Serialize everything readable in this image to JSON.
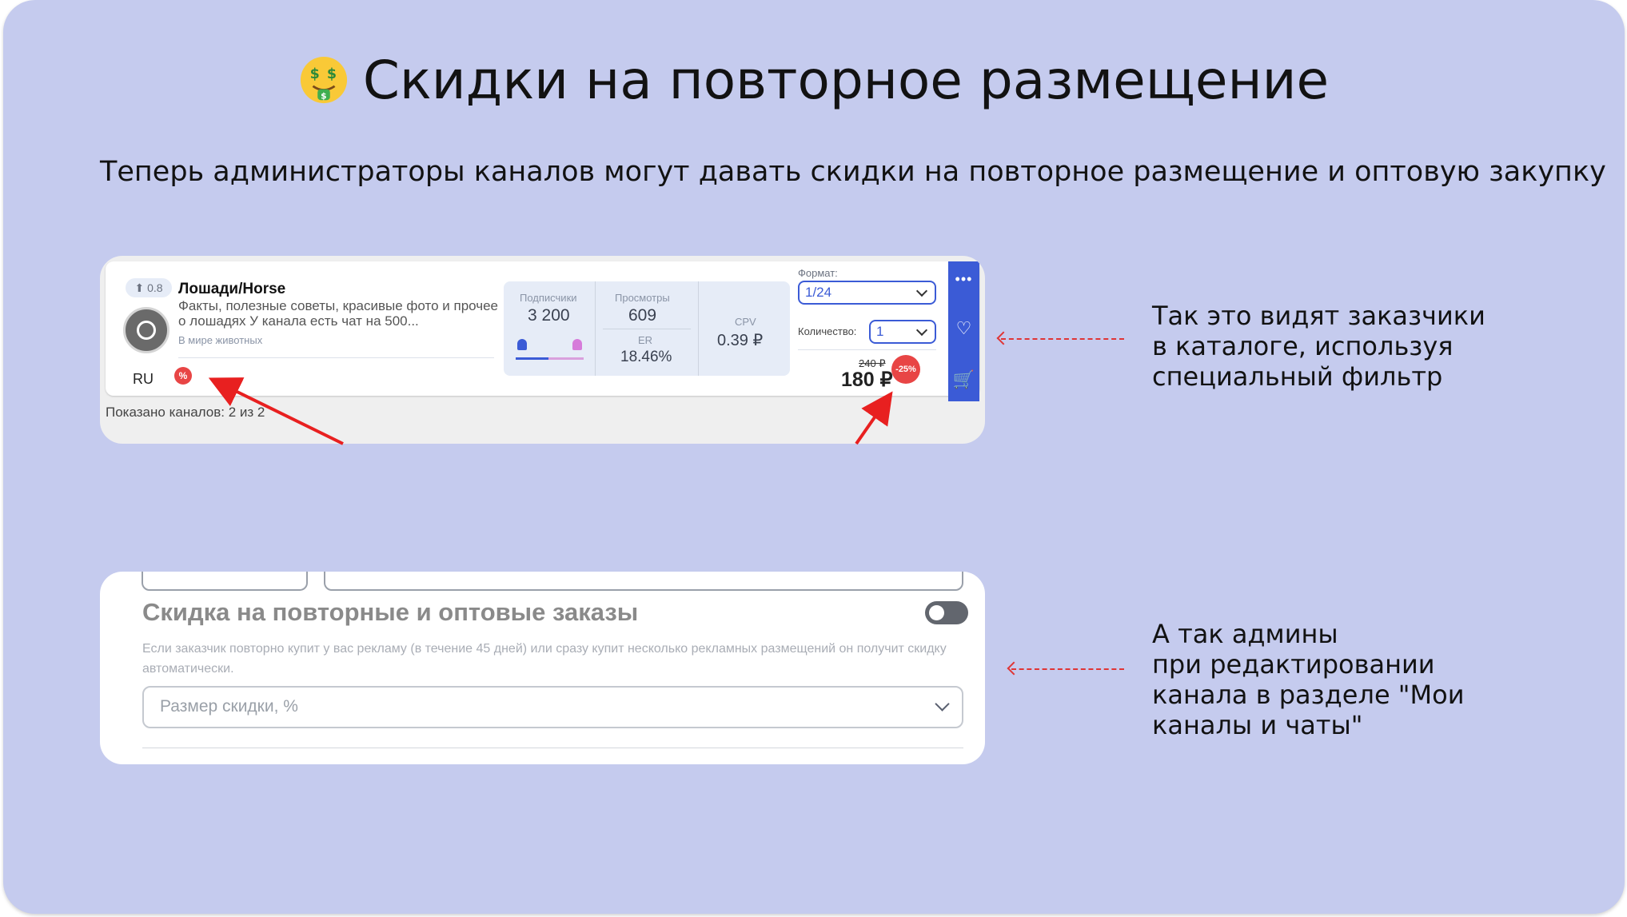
{
  "slide": {
    "title": "Скидки на повторное размещение",
    "title_emoji": "money-mouth-face-icon",
    "subtitle": "Теперь администраторы каналов могут давать скидки на повторное размещение и оптовую закупку",
    "note1": [
      "Так это видят заказчики",
      "в каталоге, используя",
      "специальный фильтр"
    ],
    "note2": [
      "А так админы",
      "при редактировании",
      "канала в разделе \"Мои",
      "каналы и чаты\""
    ],
    "accent_color": "#e03535",
    "background_color": "#c5cbee"
  },
  "catalog_card": {
    "rating": "0.8",
    "channel_name": "Лошади/Horse",
    "description": "Факты, полезные советы, красивые фото и прочее о лошадях У канала есть чат на 500...",
    "category": "В мире животных",
    "language": "RU",
    "discount_badge": "%",
    "stats": {
      "subscribers_label": "Подписчики",
      "subscribers": "3 200",
      "views_label": "Просмотры",
      "views": "609",
      "er_label": "ER",
      "er": "18.46%",
      "cpv_label": "CPV",
      "cpv": "0.39 ₽",
      "gender_male_share": 0.48
    },
    "format_label": "Формат:",
    "format_value": "1/24",
    "quantity_label": "Количество:",
    "quantity_value": "1",
    "old_price": "240 ₽",
    "new_price": "180 ₽",
    "discount": "-25%",
    "shown_text": "Показано каналов: 2 из 2",
    "brand_color": "#3b5bd6"
  },
  "edit_card": {
    "title": "Скидка на повторные и оптовые заказы",
    "description": "Если заказчик повторно купит у вас рекламу (в течение 45 дней) или сразу купит несколько рекламных размещений он получит скидку автоматически.",
    "select_placeholder": "Размер скидки, %",
    "toggle_on": false
  }
}
